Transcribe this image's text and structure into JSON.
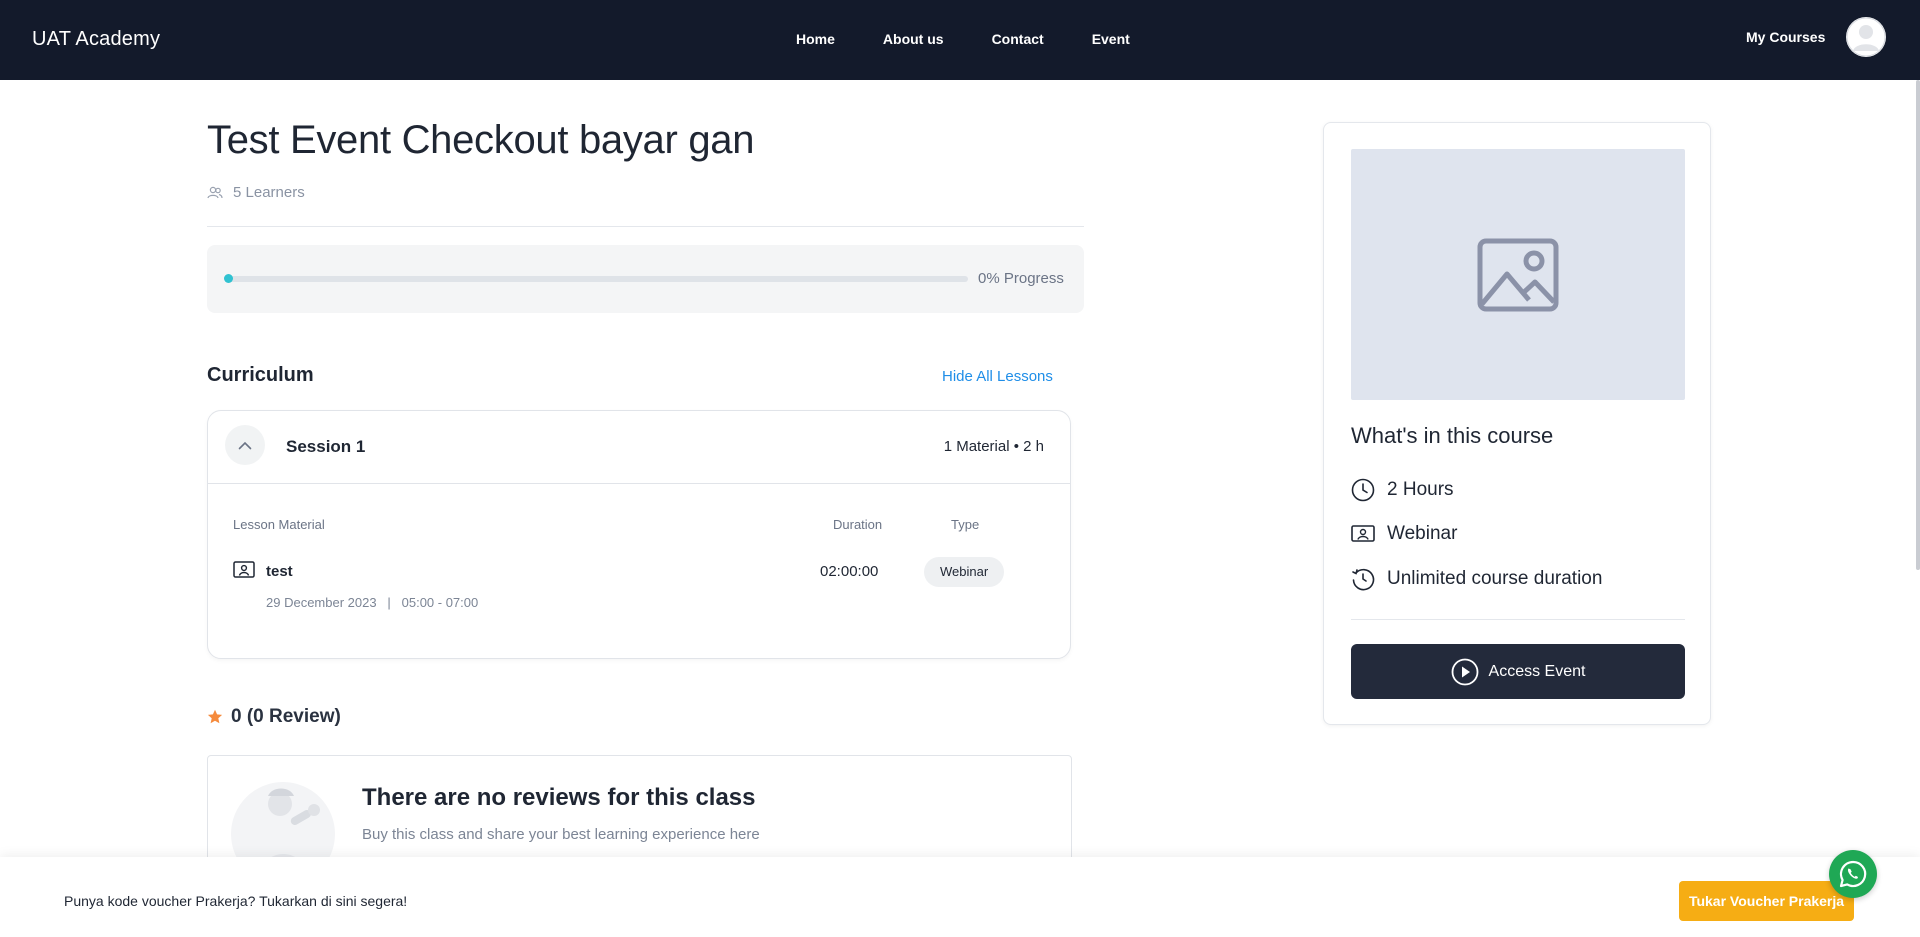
{
  "header": {
    "brand": "UAT Academy",
    "nav": [
      {
        "label": "Home"
      },
      {
        "label": "About us"
      },
      {
        "label": "Contact"
      },
      {
        "label": "Event"
      }
    ],
    "my_courses": "My Courses"
  },
  "course": {
    "title": "Test Event Checkout bayar gan",
    "learners": "5 Learners",
    "progress_label": "0% Progress",
    "progress_value": 0
  },
  "curriculum": {
    "title": "Curriculum",
    "toggle_label": "Hide All Lessons",
    "session": {
      "title": "Session 1",
      "meta": "1 Material • 2 h",
      "columns": {
        "material": "Lesson Material",
        "duration": "Duration",
        "type": "Type"
      },
      "lesson": {
        "name": "test",
        "schedule": "29 December 2023   |   05:00 - 07:00",
        "duration": "02:00:00",
        "type": "Webinar"
      }
    }
  },
  "reviews": {
    "summary": "0 (0 Review)",
    "empty_title": "There are no reviews for this class",
    "empty_sub": "Buy this class and share your best learning experience here"
  },
  "sidebar": {
    "heading": "What's in this course",
    "features": [
      {
        "icon": "clock-icon",
        "label": "2 Hours"
      },
      {
        "icon": "webinar-icon",
        "label": "Webinar"
      },
      {
        "icon": "history-icon",
        "label": "Unlimited course duration"
      }
    ],
    "cta": "Access Event"
  },
  "bottom_bar": {
    "text": "Punya kode voucher Prakerja? Tukarkan di sini segera!",
    "button": "Tukar Voucher Prakerja"
  },
  "colors": {
    "navbar": "#131a2b",
    "accent_link": "#1f8ee8",
    "progress": "#30c2d1",
    "cta": "#232a3b",
    "voucher": "#f6ad14",
    "whatsapp": "#1fa855",
    "star": "#f58a3c"
  }
}
